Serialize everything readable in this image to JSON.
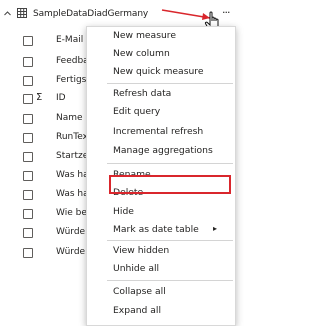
{
  "table": {
    "name": "SampleDataDiadGermany",
    "more_glyph": "···"
  },
  "fields": [
    {
      "label": "E-Mail",
      "sigma": ""
    },
    {
      "label": "Feedba",
      "sigma": ""
    },
    {
      "label": "Fertigs",
      "sigma": ""
    },
    {
      "label": "ID",
      "sigma": "Σ"
    },
    {
      "label": "Name",
      "sigma": ""
    },
    {
      "label": "RunTex",
      "sigma": ""
    },
    {
      "label": "Startze",
      "sigma": ""
    },
    {
      "label": "Was ha",
      "sigma": ""
    },
    {
      "label": "Was ha",
      "sigma": ""
    },
    {
      "label": "Wie be",
      "sigma": ""
    },
    {
      "label": "Würde",
      "sigma": ""
    },
    {
      "label": "Würde",
      "sigma": ""
    }
  ],
  "menu": {
    "items": [
      {
        "label": "New measure"
      },
      {
        "label": "New column"
      },
      {
        "label": "New quick measure"
      },
      {
        "label": "Refresh data"
      },
      {
        "label": "Edit query"
      },
      {
        "label": "Incremental refresh"
      },
      {
        "label": "Manage aggregations"
      },
      {
        "label": "Rename"
      },
      {
        "label": "Delete"
      },
      {
        "label": "Hide"
      },
      {
        "label": "Mark as date table",
        "submenu_glyph": "▸"
      },
      {
        "label": "View hidden"
      },
      {
        "label": "Unhide all"
      },
      {
        "label": "Collapse all"
      },
      {
        "label": "Expand all"
      }
    ]
  },
  "colors": {
    "annotation_red": "#d9262c",
    "text": "#252423"
  }
}
